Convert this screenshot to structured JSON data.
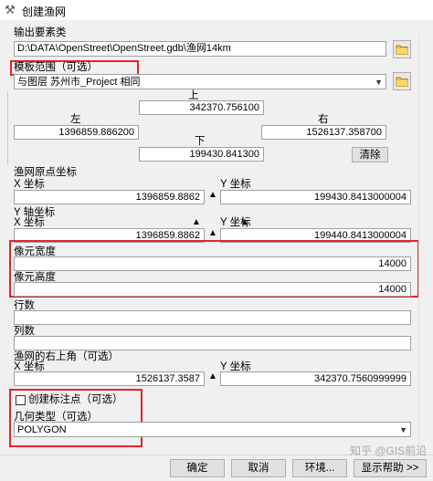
{
  "window": {
    "title": "创建渔网"
  },
  "output": {
    "label": "输出要素类",
    "value": "D:\\DATA\\OpenStreet\\OpenStreet.gdb\\渔网14km"
  },
  "template": {
    "label": "模板范围（可选）",
    "value": "与图层 苏州市_Project 相同"
  },
  "extent": {
    "top_label": "上",
    "top_value": "342370.756100",
    "left_label": "左",
    "left_value": "1396859.886200",
    "right_label": "右",
    "right_value": "1526137.358700",
    "bottom_label": "下",
    "bottom_value": "199430.841300",
    "clear_label": "清除"
  },
  "origin": {
    "label": "渔网原点坐标",
    "x_label": "X 坐标",
    "x_value": "1396859.8862",
    "y_label": "Y 坐标",
    "y_value": "199430.8413000004"
  },
  "yaxis": {
    "label": "Y 轴坐标",
    "x_label": "X 坐标",
    "x_value": "1396859.8862",
    "y_label": "Y 坐标",
    "y_value": "199440.8413000004"
  },
  "cell": {
    "width_label": "像元宽度",
    "width_value": "14000",
    "height_label": "像元高度",
    "height_value": "14000"
  },
  "rows": {
    "label": "行数",
    "value": ""
  },
  "cols": {
    "label": "列数",
    "value": ""
  },
  "corner": {
    "label": "渔网的右上角（可选）",
    "x_label": "X 坐标",
    "x_value": "1526137.3587",
    "y_label": "Y 坐标",
    "y_value": "342370.7560999999"
  },
  "label_points": {
    "label": "创建标注点（可选）",
    "checked": false
  },
  "geometry": {
    "label": "几何类型（可选）",
    "value": "POLYGON"
  },
  "footer": {
    "ok": "确定",
    "cancel": "取消",
    "env": "环境...",
    "help": "显示帮助 >>",
    "watermark": "知乎 @GIS前沿"
  }
}
